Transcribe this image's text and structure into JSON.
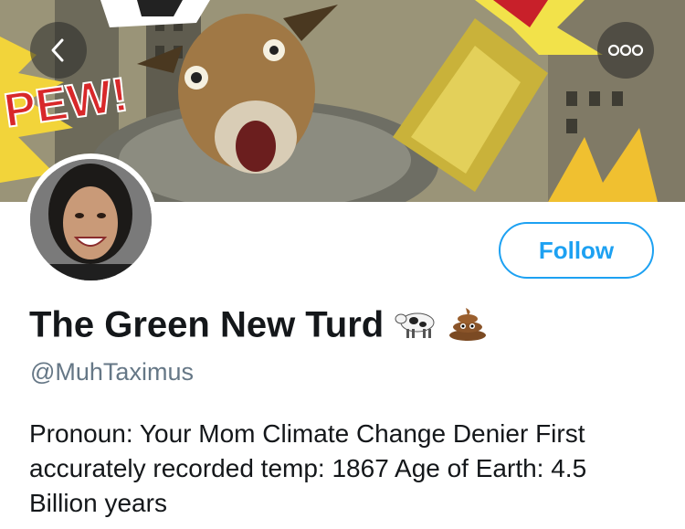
{
  "banner": {
    "description_icon": "comic-banner-image",
    "sfx_text": "PEW!"
  },
  "nav": {
    "back_icon": "chevron-left-icon",
    "more_icon": "more-dots-icon",
    "more_label": "ooo"
  },
  "profile": {
    "display_name": "The Green New Turd",
    "name_emojis": [
      "cow-icon",
      "poop-icon"
    ],
    "handle": "@MuhTaximus",
    "bio": "Pronoun: Your Mom Climate Change Denier First accurately recorded temp: 1867 Age of Earth: 4.5 Billion years",
    "follow_label": "Follow"
  },
  "colors": {
    "accent": "#1da1f2",
    "text_primary": "#14171a",
    "text_secondary": "#657786"
  }
}
